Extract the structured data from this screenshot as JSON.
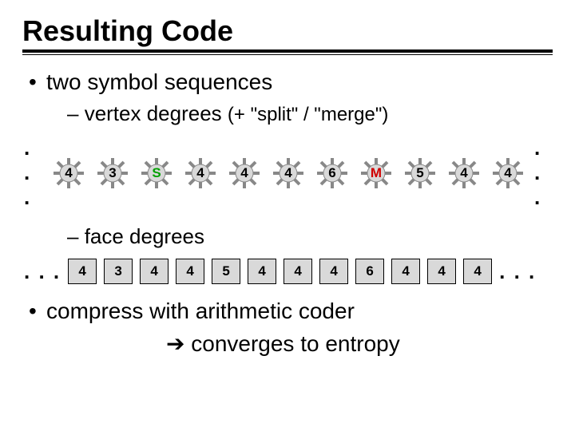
{
  "title": "Resulting Code",
  "bullet1": "two symbol sequences",
  "sub1_pre": "vertex degrees ",
  "sub1_paren": "(+ \"split\" / \"merge\")",
  "vertex_seq": [
    "4",
    "3",
    "S",
    "4",
    "4",
    "4",
    "6",
    "M",
    "5",
    "4",
    "4"
  ],
  "sub2": "face degrees",
  "face_seq": [
    "4",
    "3",
    "4",
    "4",
    "5",
    "4",
    "4",
    "4",
    "6",
    "4",
    "4",
    "4"
  ],
  "bullet2": "compress with arithmetic coder",
  "conclusion": "converges to entropy",
  "ellipsis": ". . .",
  "arrow_glyph": "➔",
  "split_sym": "S",
  "merge_sym": "M"
}
